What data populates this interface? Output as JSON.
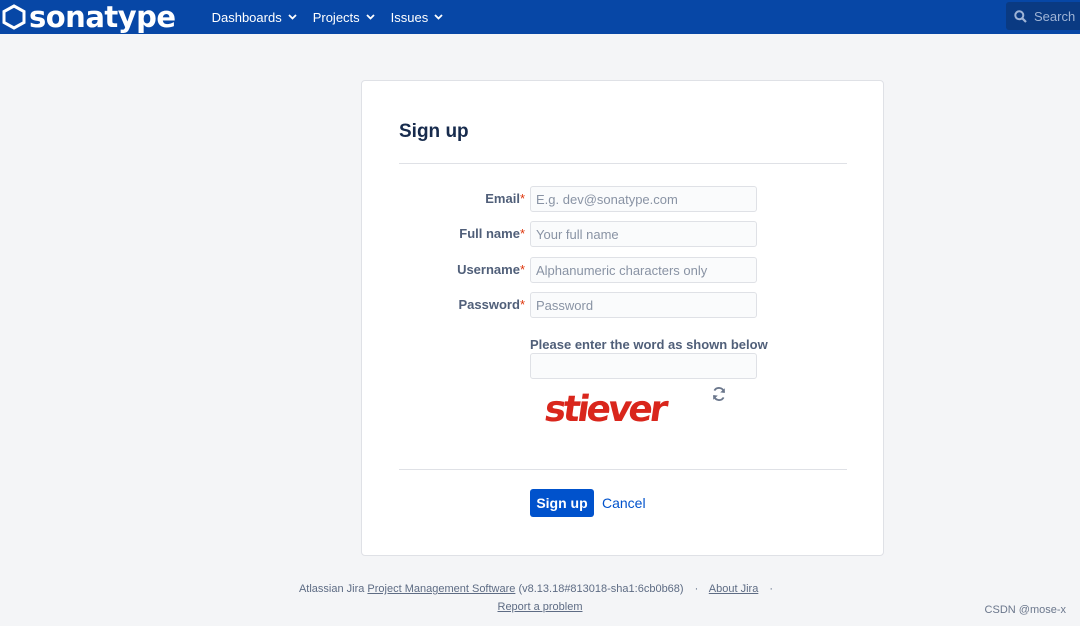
{
  "header": {
    "logo_text": "sonatype",
    "nav": [
      {
        "label": "Dashboards"
      },
      {
        "label": "Projects"
      },
      {
        "label": "Issues"
      }
    ],
    "search_placeholder": "Search"
  },
  "form": {
    "title": "Sign up",
    "fields": {
      "email": {
        "label": "Email",
        "placeholder": "E.g. dev@sonatype.com"
      },
      "fullname": {
        "label": "Full name",
        "placeholder": "Your full name"
      },
      "username": {
        "label": "Username",
        "placeholder": "Alphanumeric characters only"
      },
      "password": {
        "label": "Password",
        "placeholder": "Password"
      }
    },
    "required_marker": "*",
    "captcha_label": "Please enter the word as shown below",
    "captcha_word": "stiever",
    "submit_label": "Sign up",
    "cancel_label": "Cancel"
  },
  "footer": {
    "prefix": "Atlassian Jira",
    "pms_link": "Project Management Software",
    "version": "(v8.13.18#813018-sha1:6cb0b68)",
    "about_link": "About Jira",
    "dot": "·",
    "report_link": "Report a problem"
  },
  "watermark": "CSDN @mose-x",
  "colors": {
    "header_bg": "#0747a6",
    "primary": "#0052cc",
    "required": "#de350b",
    "captcha": "#d9261c"
  }
}
